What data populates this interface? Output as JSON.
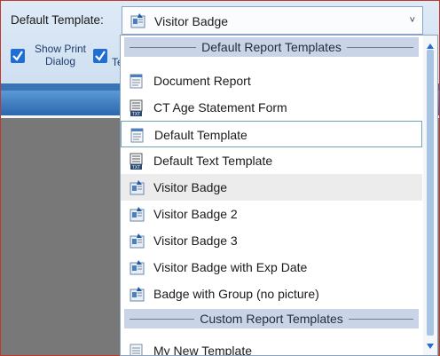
{
  "toolbar": {
    "default_template_label": "Default Template:",
    "combo_value": "Visitor Badge",
    "show_print_dialog_line1": "Show Print",
    "show_print_dialog_line2": "Dialog",
    "second_checkbox_partial": "Te"
  },
  "dropdown": {
    "groups": [
      {
        "header": "Default Report Templates"
      },
      {
        "header": "Custom Report Templates"
      }
    ],
    "items": [
      {
        "label": "Document Report",
        "icon": "document-report-icon"
      },
      {
        "label": "CT Age Statement Form",
        "icon": "txt-file-icon"
      },
      {
        "label": "Default Template",
        "icon": "document-report-icon",
        "state": "selected"
      },
      {
        "label": "Default Text Template",
        "icon": "txt-file-icon"
      },
      {
        "label": "Visitor Badge",
        "icon": "badge-icon",
        "state": "hover"
      },
      {
        "label": "Visitor Badge 2",
        "icon": "badge-icon"
      },
      {
        "label": "Visitor Badge 3",
        "icon": "badge-icon"
      },
      {
        "label": "Visitor Badge with Exp Date",
        "icon": "badge-icon"
      },
      {
        "label": "Badge with Group (no picture)",
        "icon": "badge-icon"
      },
      {
        "label": "My New Template",
        "icon": "document-report-icon"
      }
    ]
  },
  "colors": {
    "checkbox": "#1e6ed6",
    "group_header_bg": "#c9d5e6",
    "selected_border": "#6fa3b8",
    "hover_bg": "#ececec"
  }
}
